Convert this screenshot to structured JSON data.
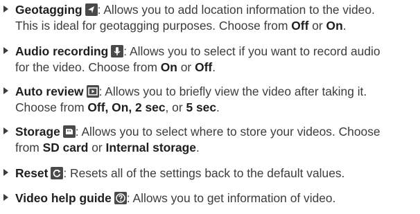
{
  "items": [
    {
      "title": "Geotagging",
      "icon": "geotag-icon",
      "line1": ": Allows you to add location information to the video.",
      "line2_pre": "This is ideal for geotagging purposes. Choose from ",
      "opt1": "Off",
      "sep1": " or ",
      "opt2": "On",
      "end": "."
    },
    {
      "title": "Audio recording",
      "icon": "microphone-icon",
      "line1": ": Allows you to select if you want to record audio",
      "line2_pre": "for the video. Choose from ",
      "opt1": "On",
      "sep1": " or ",
      "opt2": "Off",
      "end": "."
    },
    {
      "title": "Auto review",
      "icon": "auto-review-icon",
      "line1": ": Allows you to briefly view the video after taking it.",
      "line2_pre": "Choose from ",
      "opt1": "Off, On, 2 sec",
      "sep1": ", or ",
      "opt2": "5 sec",
      "end": "."
    },
    {
      "title": "Storage",
      "icon": "storage-icon",
      "line1": ": Allows you to select where to store your videos. Choose",
      "line2_pre": "from ",
      "opt1": "SD card",
      "sep1": " or ",
      "opt2": "Internal storage",
      "end": "."
    },
    {
      "title": "Reset",
      "icon": "reset-icon",
      "line1": ": Resets all of the settings back to the default values."
    },
    {
      "title": "Video help guide",
      "icon": "help-icon",
      "line1": ": Allows you to get information of video."
    }
  ]
}
